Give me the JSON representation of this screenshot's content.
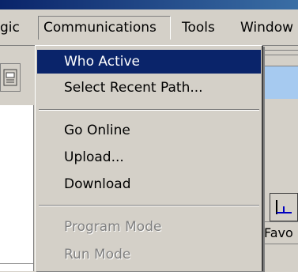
{
  "menubar": {
    "items": [
      {
        "label": "gic"
      },
      {
        "label": "Communications"
      },
      {
        "label": "Tools"
      },
      {
        "label": "Window"
      }
    ]
  },
  "dropdown": {
    "items": [
      {
        "label": "Who Active",
        "state": "selected"
      },
      {
        "label": "Select Recent Path..."
      },
      {
        "label": "Go Online"
      },
      {
        "label": "Upload..."
      },
      {
        "label": "Download"
      },
      {
        "label": "Program Mode",
        "state": "disabled"
      },
      {
        "label": "Run Mode",
        "state": "disabled"
      }
    ]
  },
  "right_panel": {
    "tab_label": "Favo"
  },
  "colors": {
    "menu_highlight": "#0a246a",
    "window_bg": "#d4d0c8",
    "field_blue": "#a6caf0"
  }
}
